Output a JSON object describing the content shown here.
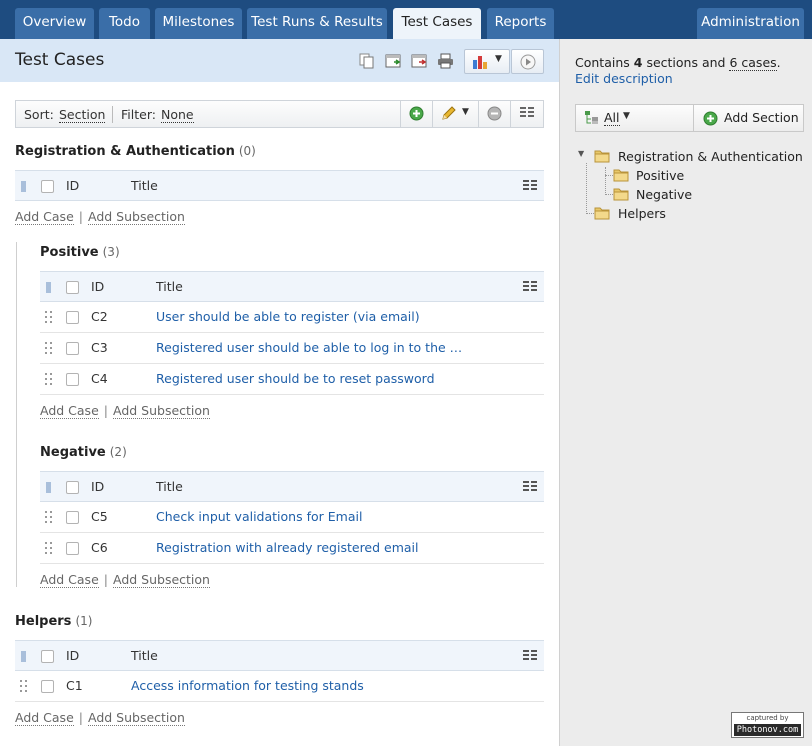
{
  "nav": {
    "tabs": [
      "Overview",
      "Todo",
      "Milestones",
      "Test Runs & Results",
      "Test Cases",
      "Reports"
    ],
    "active_tab": "Test Cases",
    "admin": "Administration"
  },
  "page": {
    "title": "Test Cases"
  },
  "sortbar": {
    "sort_label": "Sort:",
    "sort_value": "Section",
    "filter_label": "Filter:",
    "filter_value": "None"
  },
  "columns": {
    "id": "ID",
    "title": "Title"
  },
  "actions": {
    "add_case": "Add Case",
    "add_subsection": "Add Subsection",
    "separator": "|"
  },
  "sections": [
    {
      "name": "Registration & Authentication",
      "count": "(0)",
      "cases": []
    },
    {
      "name": "Positive",
      "count": "(3)",
      "cases": [
        {
          "id": "C2",
          "title": "User should be able to register (via email)"
        },
        {
          "id": "C3",
          "title": "Registered user should be able to log in to the …"
        },
        {
          "id": "C4",
          "title": "Registered user should be to reset password"
        }
      ]
    },
    {
      "name": "Negative",
      "count": "(2)",
      "cases": [
        {
          "id": "C5",
          "title": "Check input validations for Email"
        },
        {
          "id": "C6",
          "title": "Registration with already registered email"
        }
      ]
    },
    {
      "name": "Helpers",
      "count": "(1)",
      "cases": [
        {
          "id": "C1",
          "title": "Access information for testing stands"
        }
      ]
    }
  ],
  "sidebar": {
    "summary_prefix": "Contains",
    "sections_count": "4",
    "sections_word": "sections and",
    "cases_count": "6 cases",
    "edit_link": "Edit description",
    "filter_all": "All",
    "add_section": "Add Section",
    "tree": [
      "Registration & Authentication",
      "Positive",
      "Negative",
      "Helpers"
    ]
  },
  "watermark": {
    "line1": "captured by",
    "line2": "Photonov.com"
  },
  "colors": {
    "nav_bg": "#1e4c80",
    "tab_bg": "#3a6ea8",
    "link": "#1f5fa8",
    "header_bg": "#d9e7f6"
  }
}
